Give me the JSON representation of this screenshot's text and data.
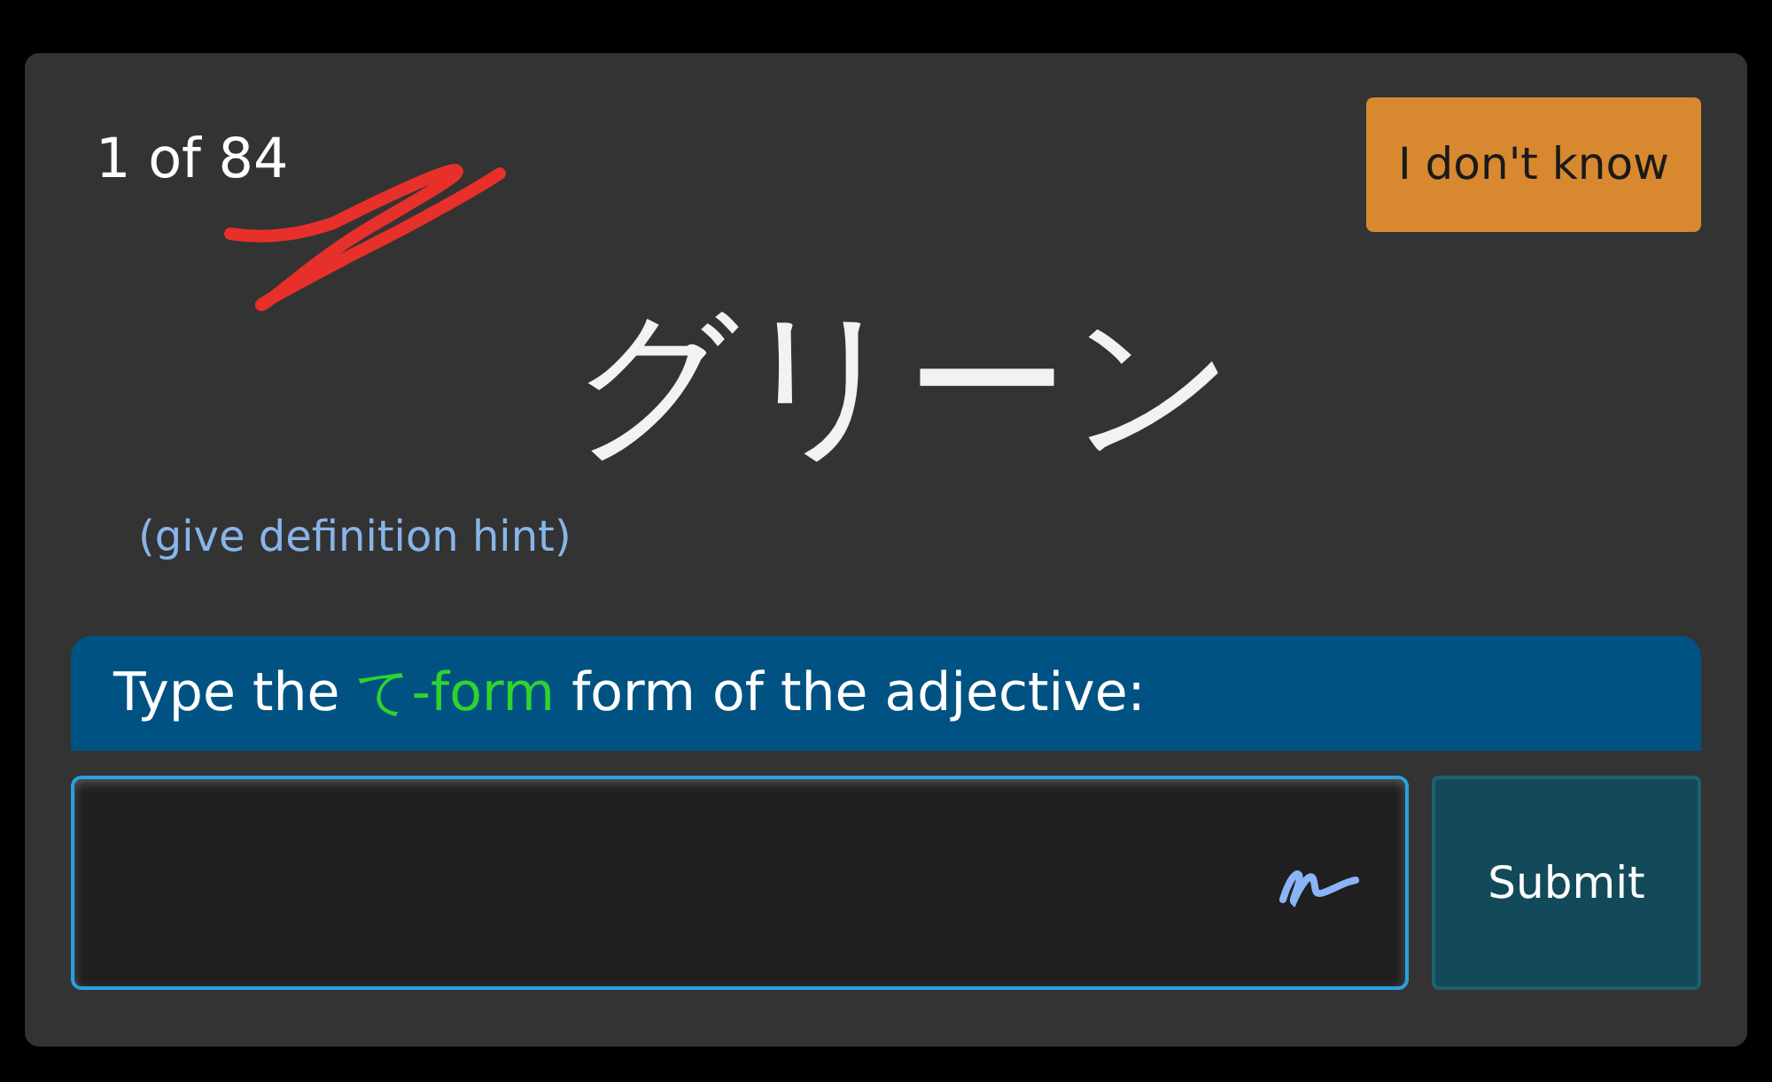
{
  "counter": "1 of 84",
  "dont_know_button": "I don't know",
  "word": "グリーン",
  "hint_link": "(give definition hint)",
  "prompt": {
    "before": "Type the",
    "highlight": "て-form",
    "after": "form of the adjective:"
  },
  "submit_button": "Submit"
}
